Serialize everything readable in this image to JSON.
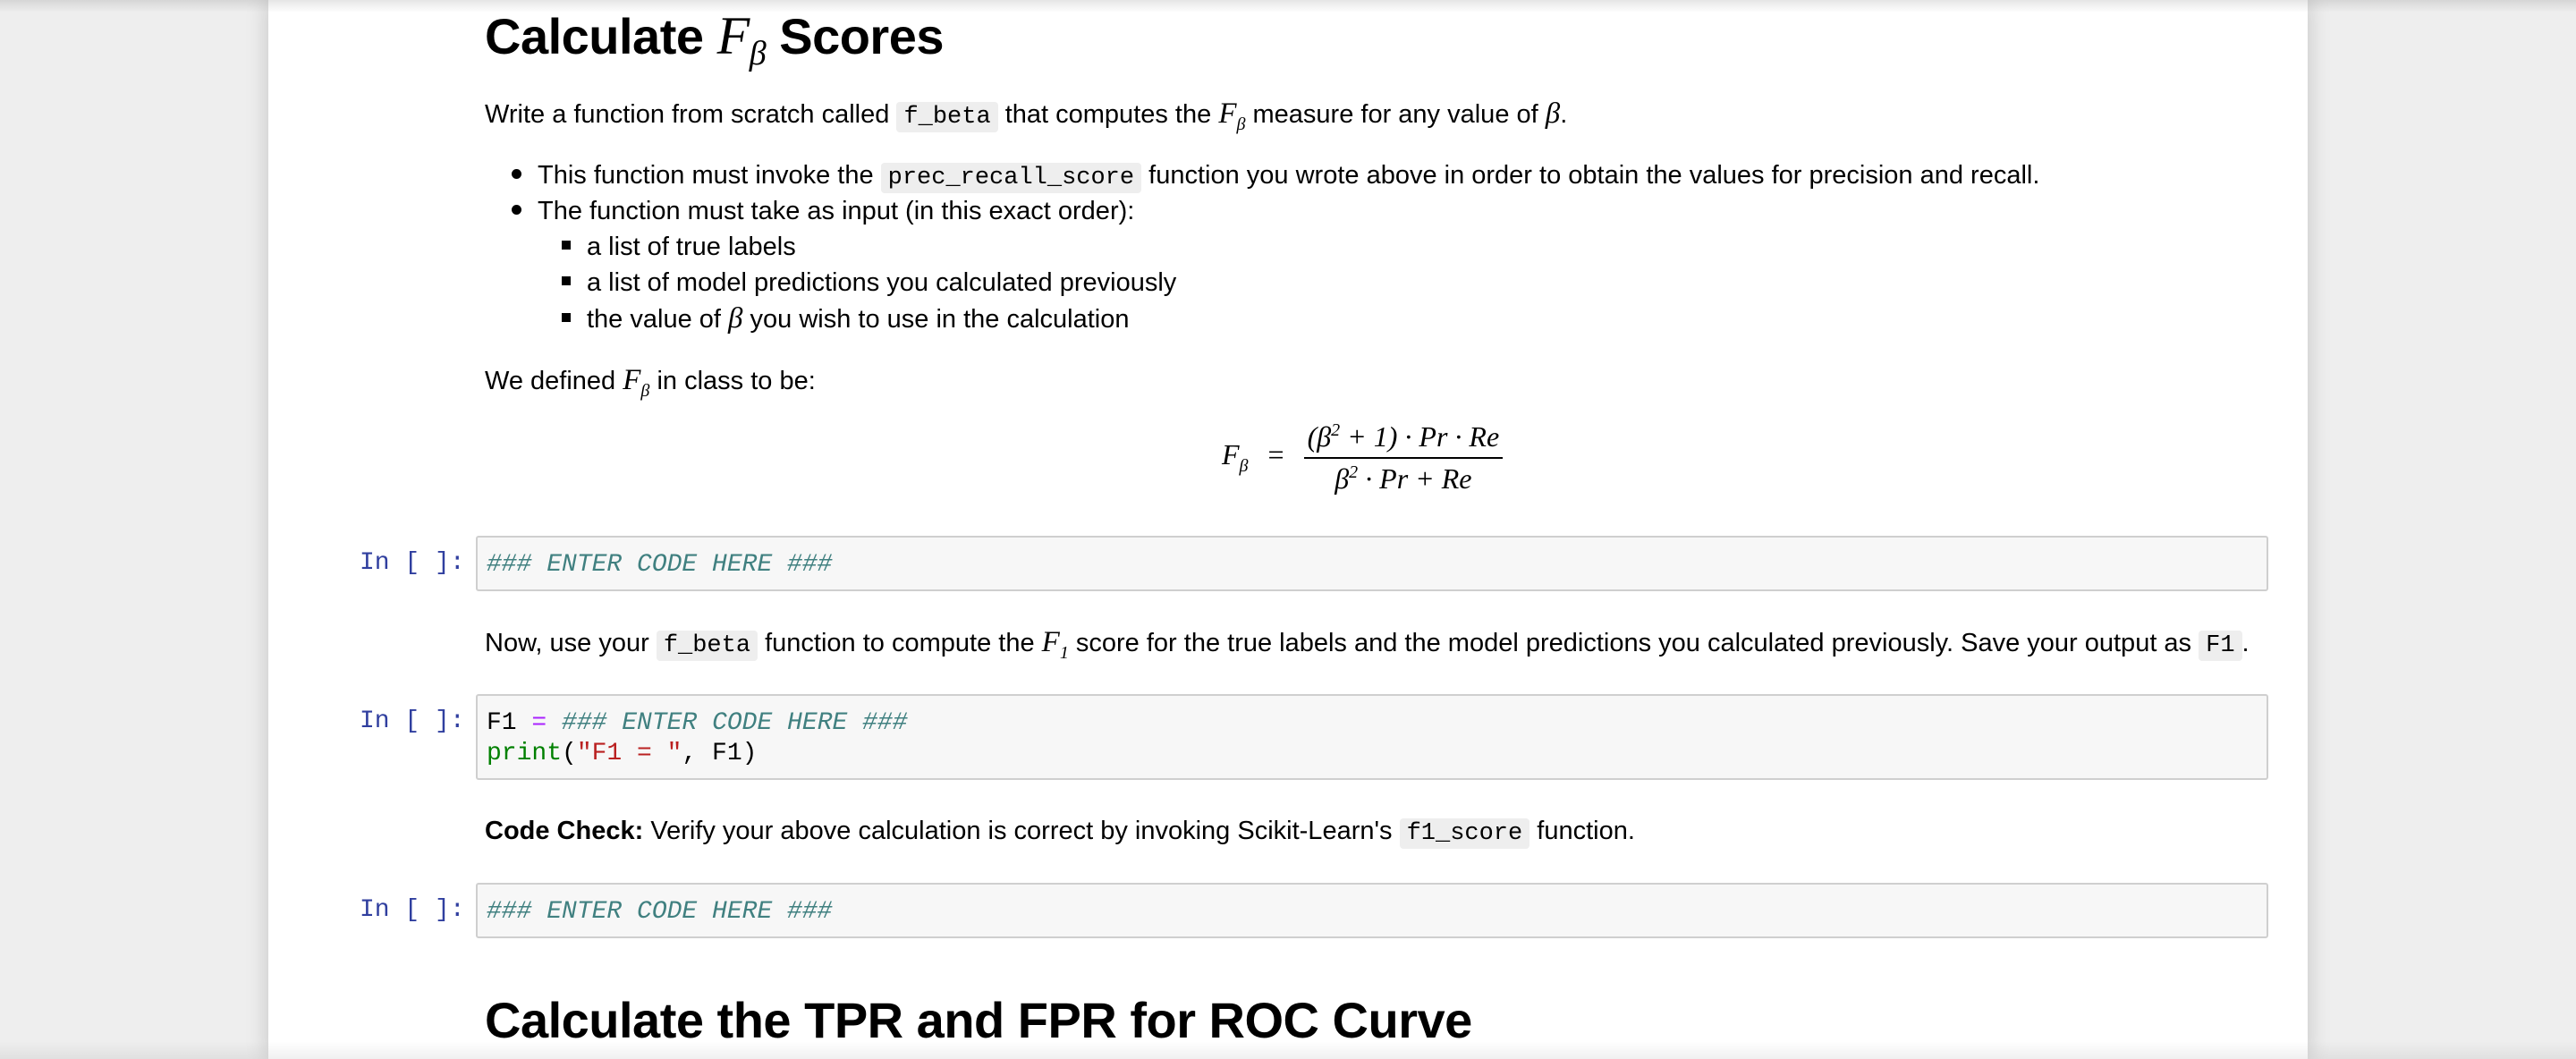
{
  "section1": {
    "heading_pre": "Calculate",
    "heading_math": "F",
    "heading_sub": "β",
    "heading_post": "Scores",
    "intro_pre": "Write a function from scratch called",
    "intro_code": "f_beta",
    "intro_mid": "that computes the",
    "intro_math": "F",
    "intro_sub": "β",
    "intro_post": "measure for any value of",
    "intro_beta": "β",
    "intro_end": ".",
    "bullet1_pre": "This function must invoke the",
    "bullet1_code": "prec_recall_score",
    "bullet1_post": "function you wrote above in order to obtain the values for precision and recall.",
    "bullet2": "The function must take as input (in this exact order):",
    "sub1": "a list of true labels",
    "sub2": "a list of model predictions you calculated previously",
    "sub3_pre": "the value of",
    "sub3_math": "β",
    "sub3_post": "you wish to use in the calculation",
    "defined_pre": "We defined",
    "defined_math": "F",
    "defined_sub": "β",
    "defined_post": "in class to be:"
  },
  "formula": {
    "lhs": "F",
    "lhs_sub": "β",
    "equals": "=",
    "num_a": "(β",
    "num_sup": "2",
    "num_b": " + 1) · Pr · Re",
    "den_a": "β",
    "den_sup": "2",
    "den_b": " · Pr + Re"
  },
  "cells": [
    {
      "prompt": "In [ ]:",
      "line1_comment": "### ENTER CODE HERE ###"
    },
    {
      "prompt": "In [ ]:",
      "line1_var": "F1",
      "line1_op": "=",
      "line1_comment": "### ENTER CODE HERE ###",
      "line2_fn": "print",
      "line2_open": "(",
      "line2_str": "\"F1 = \"",
      "line2_rest": ", F1)"
    },
    {
      "prompt": "In [ ]:",
      "line1_comment": "### ENTER CODE HERE ###"
    }
  ],
  "f1_text": {
    "pre": "Now, use your",
    "code": "f_beta",
    "mid": "function to compute the",
    "math": "F",
    "sub": "1",
    "post": "score for the true labels and the model predictions you calculated previously. Save your output as",
    "code2": "F1",
    "end": "."
  },
  "code_check": {
    "bold": "Code Check:",
    "pre": "Verify your above calculation is correct by invoking Scikit-Learn's",
    "code": "f1_score",
    "post": "function."
  },
  "section2": {
    "heading": "Calculate the TPR and FPR for ROC Curve"
  }
}
